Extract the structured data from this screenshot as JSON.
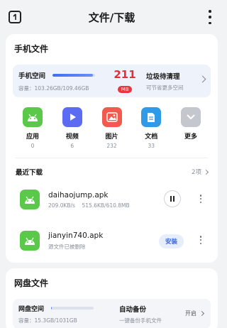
{
  "header": {
    "title": "文件/下载"
  },
  "phone_files": {
    "section_title": "手机文件",
    "storage": {
      "label": "手机空间",
      "usage": "容量：103.26GB/109.46GB",
      "used_fraction": 0.943
    },
    "junk": {
      "number": "211",
      "unit": "MB",
      "title": "垃圾待清理",
      "subtitle": "可节省更多空间"
    },
    "categories": [
      {
        "name": "应用",
        "count": "0",
        "icon": "android-icon",
        "color": "#5ac94a"
      },
      {
        "name": "视频",
        "count": "6",
        "icon": "play-icon",
        "color": "#5b6cf2"
      },
      {
        "name": "图片",
        "count": "232",
        "icon": "image-icon",
        "color": "#f05a4f"
      },
      {
        "name": "文档",
        "count": "33",
        "icon": "document-icon",
        "color": "#2f9ae8"
      },
      {
        "name": "更多",
        "count": "",
        "icon": "chevron-down-icon",
        "color": "#c4c8ce"
      }
    ],
    "recent": {
      "title": "最近下载",
      "count": "2项",
      "items": [
        {
          "name": "daihaojump.apk",
          "status": "209.0KB/s    515.6KB/610.8MB"
        },
        {
          "name": "jianyin740.apk",
          "status": "源文件已被删除",
          "action": "安装"
        }
      ]
    }
  },
  "cloud_files": {
    "section_title": "网盘文件",
    "storage": {
      "label": "网盘空间",
      "usage": "容量：15.3GB/1031GB",
      "used_fraction": 0.015
    },
    "backup": {
      "title": "自动备份",
      "subtitle": "一键备份手机文件",
      "action": "开启"
    }
  }
}
